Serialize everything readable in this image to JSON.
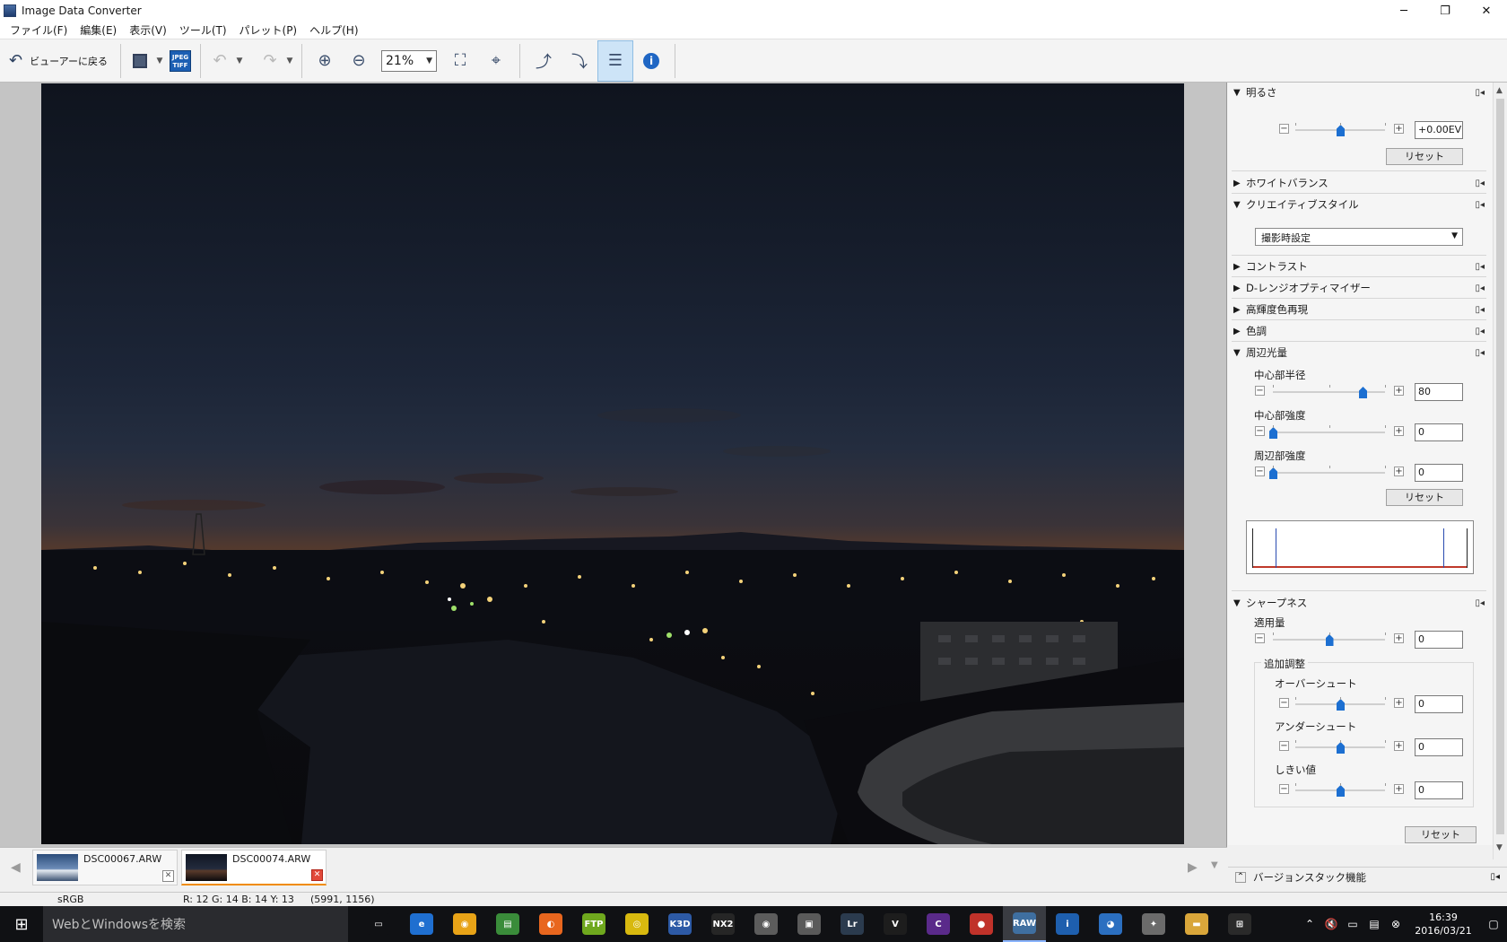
{
  "window": {
    "title": "Image Data Converter",
    "minimize": "─",
    "restore": "❐",
    "close": "✕"
  },
  "menu": [
    "ファイル(F)",
    "編集(E)",
    "表示(V)",
    "ツール(T)",
    "パレット(P)",
    "ヘルプ(H)"
  ],
  "toolbar": {
    "back_label": "ビューアーに戻る",
    "jpeg_tiff": "JPEG TIFF",
    "zoom_value": "21%"
  },
  "thumbnails": [
    {
      "name": "DSC00067.ARW",
      "selected": false
    },
    {
      "name": "DSC00074.ARW",
      "selected": true
    }
  ],
  "status": {
    "colorspace": "sRGB",
    "pixel": "R: 12 G: 14 B: 14 Y: 13",
    "coords": "(5991, 1156)"
  },
  "panel": {
    "brightness": {
      "title": "明るさ",
      "value": "+0.00EV",
      "reset": "リセット",
      "level": 0.5
    },
    "white_balance": {
      "title": "ホワイトバランス"
    },
    "creative_style": {
      "title": "クリエイティブスタイル",
      "selected": "撮影時設定"
    },
    "contrast": {
      "title": "コントラスト"
    },
    "dro": {
      "title": "D-レンジオプティマイザー"
    },
    "highlight": {
      "title": "高輝度色再現"
    },
    "tone": {
      "title": "色調"
    },
    "vignette": {
      "title": "周辺光量",
      "center_radius_label": "中心部半径",
      "center_radius_value": "80",
      "center_radius_level": 0.8,
      "center_intensity_label": "中心部強度",
      "center_intensity_value": "0",
      "center_intensity_level": 0.0,
      "peripheral_intensity_label": "周辺部強度",
      "peripheral_intensity_value": "0",
      "peripheral_intensity_level": 0.0,
      "reset": "リセット"
    },
    "sharpness": {
      "title": "シャープネス",
      "amount_label": "適用量",
      "amount_value": "0",
      "amount_level": 0.5,
      "extra_label": "追加調整",
      "overshoot_label": "オーバーシュート",
      "overshoot_value": "0",
      "overshoot_level": 0.5,
      "undershoot_label": "アンダーシュート",
      "undershoot_value": "0",
      "undershoot_level": 0.5,
      "threshold_label": "しきい値",
      "threshold_value": "0",
      "threshold_level": 0.5,
      "reset": "リセット"
    },
    "version_stack": "バージョンスタック機能"
  },
  "taskbar": {
    "search_placeholder": "WebとWindowsを検索",
    "time": "16:39",
    "date": "2016/03/21",
    "apps": [
      {
        "name": "task-view",
        "color": "#101114",
        "glyph": "▭"
      },
      {
        "name": "edge",
        "color": "#1f6fd0",
        "glyph": "e"
      },
      {
        "name": "chrome",
        "color": "#e8a317",
        "glyph": "◉"
      },
      {
        "name": "app-green",
        "color": "#3a8c3a",
        "glyph": "▤"
      },
      {
        "name": "firefox",
        "color": "#e8661e",
        "glyph": "◐"
      },
      {
        "name": "ftp",
        "color": "#6fa81e",
        "glyph": "FTP"
      },
      {
        "name": "app-yellow",
        "color": "#d8b90f",
        "glyph": "◎"
      },
      {
        "name": "k3d",
        "color": "#2d5aa6",
        "glyph": "K3D"
      },
      {
        "name": "nx2",
        "color": "#262626",
        "glyph": "NX2"
      },
      {
        "name": "viewer",
        "color": "#5c5c5c",
        "glyph": "◉"
      },
      {
        "name": "app-photo",
        "color": "#5a5a5a",
        "glyph": "▣"
      },
      {
        "name": "lightroom",
        "color": "#2b3b4e",
        "glyph": "Lr"
      },
      {
        "name": "app-v",
        "color": "#1d1d1d",
        "glyph": "V"
      },
      {
        "name": "capture",
        "color": "#5a2a8a",
        "glyph": "C"
      },
      {
        "name": "app-red",
        "color": "#c0322a",
        "glyph": "●"
      },
      {
        "name": "raw-converter",
        "color": "#3f6fa0",
        "glyph": "RAW"
      },
      {
        "name": "info",
        "color": "#1e5fae",
        "glyph": "i"
      },
      {
        "name": "app-blue",
        "color": "#2b6fc0",
        "glyph": "◕"
      },
      {
        "name": "app-gray",
        "color": "#6b6b6b",
        "glyph": "✦"
      },
      {
        "name": "explorer",
        "color": "#d9a63a",
        "glyph": "▬"
      },
      {
        "name": "store",
        "color": "#2a2a2a",
        "glyph": "⊞"
      }
    ]
  }
}
